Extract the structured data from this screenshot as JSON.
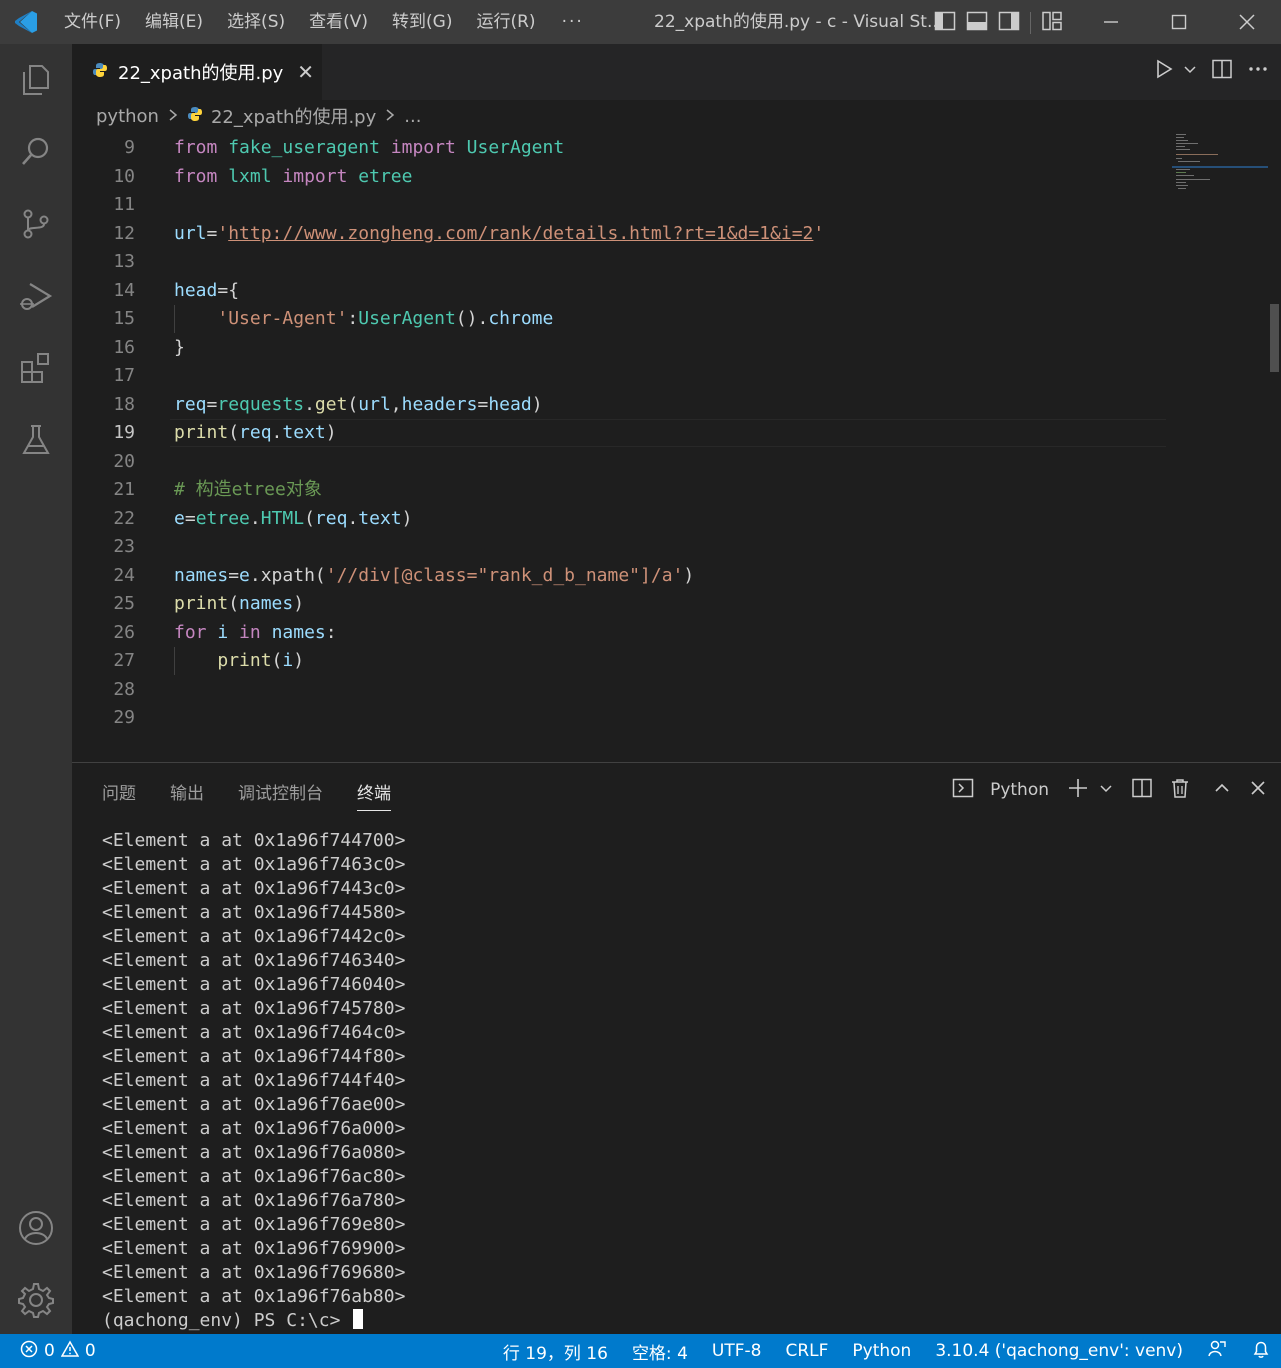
{
  "titlebar": {
    "menu": [
      "文件(F)",
      "编辑(E)",
      "选择(S)",
      "查看(V)",
      "转到(G)",
      "运行(R)"
    ],
    "more": "···",
    "title": "22_xpath的使用.py - c - Visual St..."
  },
  "tab": {
    "label": "22_xpath的使用.py",
    "close": "✕"
  },
  "breadcrumb": {
    "folder": "python",
    "file": "22_xpath的使用.py",
    "more": "..."
  },
  "editor": {
    "active_line": 19,
    "lines": [
      {
        "num": "9"
      },
      {
        "num": "10"
      },
      {
        "num": "11"
      },
      {
        "num": "12"
      },
      {
        "num": "13"
      },
      {
        "num": "14"
      },
      {
        "num": "15"
      },
      {
        "num": "16"
      },
      {
        "num": "17"
      },
      {
        "num": "18"
      },
      {
        "num": "19"
      },
      {
        "num": "20"
      },
      {
        "num": "21"
      },
      {
        "num": "22"
      },
      {
        "num": "23"
      },
      {
        "num": "24"
      },
      {
        "num": "25"
      },
      {
        "num": "26"
      },
      {
        "num": "27"
      },
      {
        "num": "28"
      },
      {
        "num": "29"
      }
    ],
    "tokens": {
      "l9": [
        "from",
        "fake_useragent",
        "import",
        "UserAgent"
      ],
      "l10": [
        "from",
        "lxml",
        "import",
        "etree"
      ],
      "l12": [
        "url",
        "=",
        "'",
        "http://www.zongheng.com/rank/details.html?rt=1&d=1&i=2",
        "'"
      ],
      "l14": [
        "head",
        "={"
      ],
      "l15": [
        "'User-Agent'",
        ":",
        "UserAgent",
        "().",
        "chrome"
      ],
      "l16": [
        "}"
      ],
      "l18": [
        "req",
        "=",
        "requests",
        ".",
        "get",
        "(",
        "url",
        ",",
        "headers",
        "=",
        "head",
        ")"
      ],
      "l19": [
        "print",
        "(",
        "req",
        ".",
        "text",
        ")"
      ],
      "l21": [
        "# 构造etree对象"
      ],
      "l22": [
        "e",
        "=",
        "etree",
        ".",
        "HTML",
        "(",
        "req",
        ".",
        "text",
        ")"
      ],
      "l24": [
        "names",
        "=",
        "e",
        ".",
        "xpath",
        "(",
        "'//div[@class=\"rank_d_b_name\"]/a'",
        ")"
      ],
      "l25": [
        "print",
        "(",
        "names",
        ")"
      ],
      "l26": [
        "for",
        "i",
        "in",
        "names",
        ":"
      ],
      "l27": [
        "print",
        "(",
        "i",
        ")"
      ]
    }
  },
  "panel": {
    "tabs": [
      "问题",
      "输出",
      "调试控制台",
      "终端"
    ],
    "active_tab": "终端",
    "terminal_name": "Python",
    "output": [
      "<Element a at 0x1a96f744700>",
      "<Element a at 0x1a96f7463c0>",
      "<Element a at 0x1a96f7443c0>",
      "<Element a at 0x1a96f744580>",
      "<Element a at 0x1a96f7442c0>",
      "<Element a at 0x1a96f746340>",
      "<Element a at 0x1a96f746040>",
      "<Element a at 0x1a96f745780>",
      "<Element a at 0x1a96f7464c0>",
      "<Element a at 0x1a96f744f80>",
      "<Element a at 0x1a96f744f40>",
      "<Element a at 0x1a96f76ae00>",
      "<Element a at 0x1a96f76a000>",
      "<Element a at 0x1a96f76a080>",
      "<Element a at 0x1a96f76ac80>",
      "<Element a at 0x1a96f76a780>",
      "<Element a at 0x1a96f769e80>",
      "<Element a at 0x1a96f769900>",
      "<Element a at 0x1a96f769680>",
      "<Element a at 0x1a96f76ab80>"
    ],
    "prompt": "(qachong_env) PS C:\\c> "
  },
  "statusbar": {
    "errors": "0",
    "warnings": "0",
    "position": "行 19，列 16",
    "spaces": "空格: 4",
    "encoding": "UTF-8",
    "eol": "CRLF",
    "language": "Python",
    "interpreter": "3.10.4 ('qachong_env': venv)"
  },
  "colors": {
    "accent": "#007acc",
    "titlebar": "#3c3c3c",
    "activitybar": "#333333",
    "editor_bg": "#1e1e1e",
    "keyword": "#c586c0",
    "variable": "#9cdcfe",
    "class": "#4ec9b0",
    "function": "#dcdcaa",
    "string": "#ce9178",
    "comment": "#6a9955"
  },
  "icons": {
    "activity": [
      "explorer-icon",
      "search-icon",
      "source-control-icon",
      "run-debug-icon",
      "extensions-icon",
      "testing-icon",
      "account-icon",
      "manage-gear-icon"
    ]
  }
}
